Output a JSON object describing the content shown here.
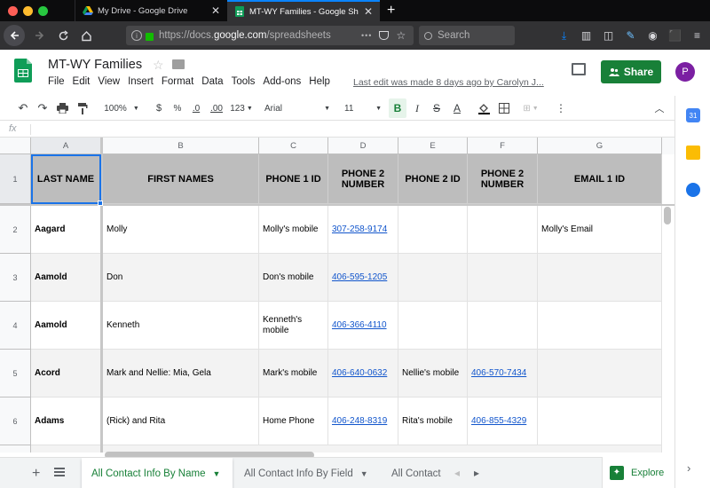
{
  "browser": {
    "tabs": [
      {
        "title": "My Drive - Google Drive",
        "active": false
      },
      {
        "title": "MT-WY Families - Google Sheets",
        "active": true
      }
    ],
    "new_tab": "+",
    "url_prefix": "https://docs.",
    "url_domain": "google.com",
    "url_path": "/spreadsheets",
    "url_more": "•••",
    "search_placeholder": "Search",
    "traffic_colors": [
      "#fe5f57",
      "#febc2e",
      "#28c840"
    ]
  },
  "doc": {
    "title": "MT-WY Families",
    "menu": [
      "File",
      "Edit",
      "View",
      "Insert",
      "Format",
      "Data",
      "Tools",
      "Add-ons",
      "Help"
    ],
    "last_edit": "Last edit was made 8 days ago by Carolyn J...",
    "share_label": "Share",
    "avatar_letter": "P",
    "brand_green": "#188038"
  },
  "toolbar": {
    "zoom": "100%",
    "currency": "$",
    "percent": "%",
    "dec_less": ".0",
    "dec_more": ".00",
    "format_more": "123",
    "font": "Arial",
    "font_size": "11",
    "bold": "B",
    "italic": "I",
    "strike": "S",
    "text_color": "A"
  },
  "formula_bar": {
    "fx": "fx",
    "value": ""
  },
  "grid": {
    "columns": [
      "A",
      "B",
      "C",
      "D",
      "E",
      "F",
      "G"
    ],
    "rows": [
      "1",
      "2",
      "3",
      "4",
      "5",
      "6"
    ],
    "header": [
      "LAST NAME",
      "FIRST NAMES",
      "PHONE 1 ID",
      "PHONE 2 NUMBER",
      "PHONE 2 ID",
      "PHONE 2 NUMBER",
      "EMAIL 1 ID"
    ],
    "data": [
      [
        "Aagard",
        "Molly",
        "Molly's mobile",
        "307-258-9174",
        "",
        "",
        "Molly's Email"
      ],
      [
        "Aamold",
        "Don",
        "Don's mobile",
        "406-595-1205",
        "",
        "",
        ""
      ],
      [
        "Aamold",
        "Kenneth",
        "Kenneth's mobile",
        "406-366-4110",
        "",
        "",
        ""
      ],
      [
        "Acord",
        "Mark and Nellie: Mia, Gela",
        "Mark's mobile",
        "406-640-0632",
        "Nellie's mobile",
        "406-570-7434",
        ""
      ],
      [
        "Adams",
        "(Rick) and Rita",
        "Home Phone",
        "406-248-8319",
        "Rita's mobile",
        "406-855-4329",
        ""
      ]
    ]
  },
  "sheets": {
    "tabs": [
      "All Contact Info By Name",
      "All Contact Info By Field",
      "All Contact"
    ],
    "add": "+",
    "explore": "Explore"
  }
}
